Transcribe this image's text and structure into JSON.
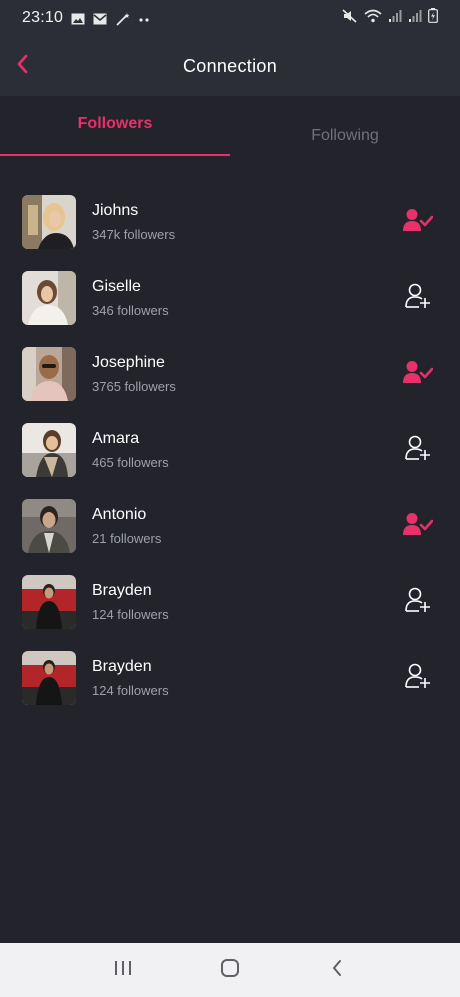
{
  "status_bar": {
    "time": "23:10"
  },
  "header": {
    "title": "Connection"
  },
  "tabs": [
    {
      "label": "Followers",
      "active": true
    },
    {
      "label": "Following",
      "active": false
    }
  ],
  "users": [
    {
      "name": "Jiohns",
      "followers": "347k followers",
      "status": "following"
    },
    {
      "name": "Giselle",
      "followers": "346 followers",
      "status": "not-following"
    },
    {
      "name": "Josephine",
      "followers": "3765 followers",
      "status": "following"
    },
    {
      "name": "Amara",
      "followers": "465 followers",
      "status": "not-following"
    },
    {
      "name": "Antonio",
      "followers": "21 followers",
      "status": "following"
    },
    {
      "name": "Brayden",
      "followers": "124 followers",
      "status": "not-following"
    },
    {
      "name": "Brayden",
      "followers": "124 followers",
      "status": "not-following"
    }
  ],
  "icons": {
    "back": "chevron-left-icon",
    "following": "user-check-icon",
    "follow": "user-plus-icon"
  },
  "colors": {
    "accent": "#e8306a",
    "background": "#22232b",
    "header": "#2c2e37",
    "subtext": "#9fa1a9"
  }
}
